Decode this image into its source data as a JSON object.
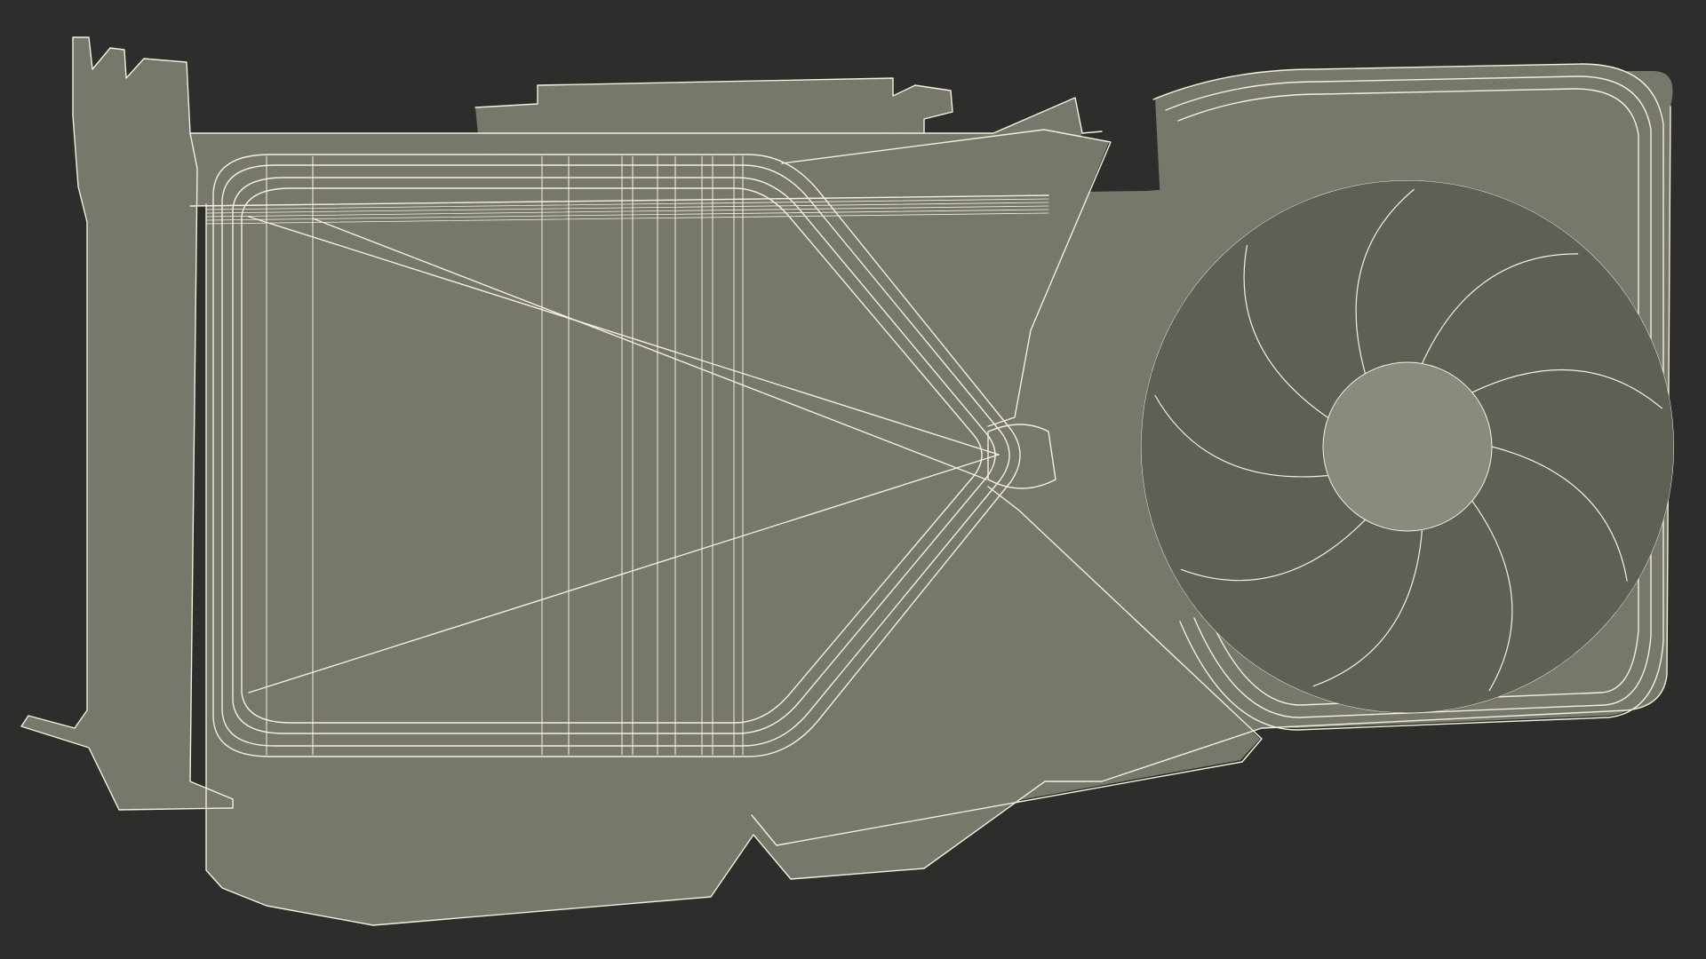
{
  "render": {
    "background_color": "#2d2d2b",
    "surface_color": "#77776b",
    "surface_light_color": "#8a8a7e",
    "surface_dark_color": "#5f5f55",
    "wire_color": "#f4f1da"
  }
}
